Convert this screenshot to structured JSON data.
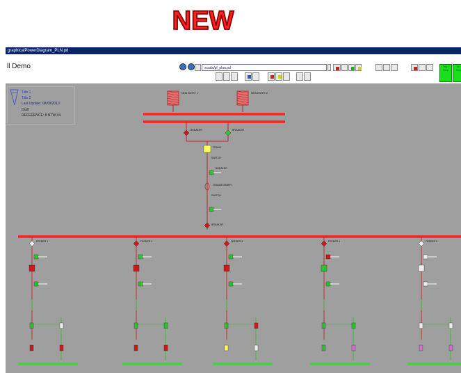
{
  "badge": {
    "text": "NEW"
  },
  "window": {
    "title": "graphicalPowerDiagram_PLN.pd"
  },
  "app": {
    "name": "ll Demo"
  },
  "toolbar": {
    "address": "scada/pl_plan.pd",
    "right_buttons": [
      "Trig / Stop",
      "Alt / Stop"
    ]
  },
  "infobox": {
    "lines": [
      "Title 1",
      "Title 2",
      "Last Update:  08/09/2013",
      "Draft",
      "REFERENCE: 8 NTW #4"
    ]
  },
  "diagram": {
    "top_labels": [
      "NEW ENTRY 1",
      "NEW ENTRY 2"
    ],
    "trunk_labels": [
      "BREAKER",
      "BREAKER",
      "TRANS",
      "SWITCH",
      "BREAKER",
      "TRANSFORMER",
      "SWITCH",
      "BREAKER",
      "BREAKER"
    ],
    "feeders": [
      "FEEDER 1",
      "FEEDER 2",
      "FEEDER 3",
      "FEEDER 4",
      "FEEDER 5"
    ]
  },
  "colors": {
    "bus": "#ff2020",
    "canvas": "#9f9f9f",
    "closed_breaker": "#d01818",
    "open_breaker": "#2ec22e",
    "feeder_bar": "#33dd33",
    "transformer": "#ffff55",
    "title_bar": "#0a246a"
  }
}
